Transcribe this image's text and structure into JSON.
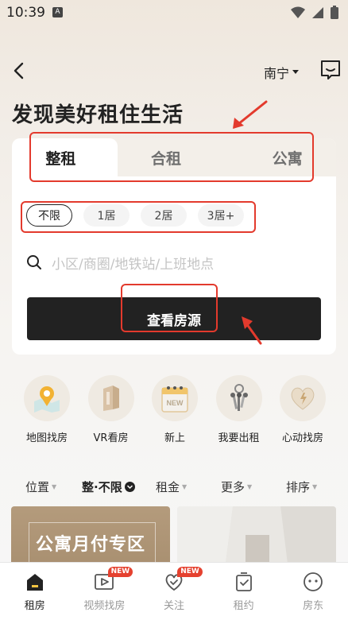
{
  "status_bar": {
    "time": "10:39",
    "notification_letter": "A"
  },
  "header": {
    "city": "南宁"
  },
  "page_title": "发现美好租住生活",
  "search_card": {
    "tabs": [
      {
        "label": "整租",
        "active": true
      },
      {
        "label": "合租",
        "active": false
      },
      {
        "label": "公寓",
        "active": false
      }
    ],
    "room_chips": [
      {
        "label": "不限",
        "active": true
      },
      {
        "label": "1居",
        "active": false
      },
      {
        "label": "2居",
        "active": false
      },
      {
        "label": "3居+",
        "active": false
      }
    ],
    "search_placeholder": "小区/商圈/地铁站/上班地点",
    "view_button": "查看房源"
  },
  "quick_entries": [
    {
      "label": "地图找房",
      "icon": "map-location-icon"
    },
    {
      "label": "VR看房",
      "icon": "vr-icon"
    },
    {
      "label": "新上",
      "icon": "new-calendar-icon"
    },
    {
      "label": "我要出租",
      "icon": "keys-icon"
    },
    {
      "label": "心动找房",
      "icon": "heart-icon"
    }
  ],
  "filters": [
    {
      "label": "位置"
    },
    {
      "label": "整·不限"
    },
    {
      "label": "租金"
    },
    {
      "label": "更多"
    },
    {
      "label": "排序"
    }
  ],
  "cards": {
    "left_title": "公寓月付专区"
  },
  "bottom_nav": [
    {
      "label": "租房",
      "active": true,
      "badge": ""
    },
    {
      "label": "视频找房",
      "active": false,
      "badge": "NEW"
    },
    {
      "label": "关注",
      "active": false,
      "badge": "NEW"
    },
    {
      "label": "租约",
      "active": false,
      "badge": ""
    },
    {
      "label": "房东",
      "active": false,
      "badge": ""
    }
  ],
  "colors": {
    "accent_dark": "#222222",
    "annotation_red": "#e33a2d",
    "badge_red": "#e5412f"
  }
}
